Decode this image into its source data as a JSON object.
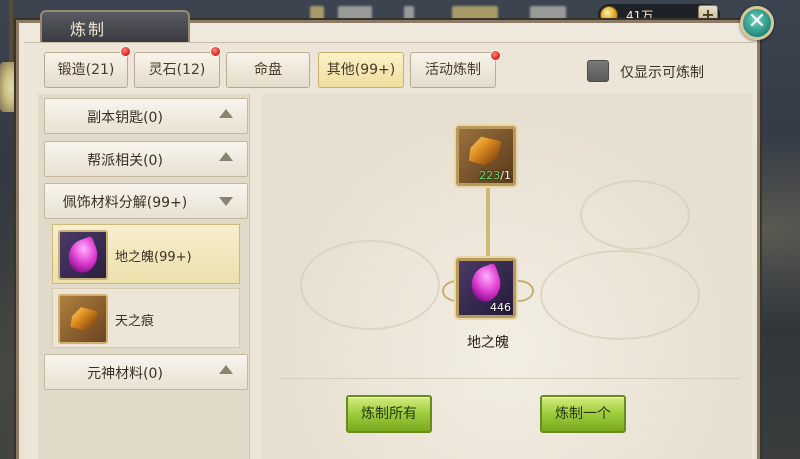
{
  "window": {
    "title": "炼制"
  },
  "currency": {
    "amount": "41万",
    "add_label": "+"
  },
  "close_label": "✕",
  "tabs": [
    {
      "label": "锻造(21)",
      "badge": true,
      "active": false
    },
    {
      "label": "灵石(12)",
      "badge": true,
      "active": false
    },
    {
      "label": "命盘",
      "badge": false,
      "active": false
    },
    {
      "label": "其他(99+)",
      "badge": false,
      "active": true
    },
    {
      "label": "活动炼制",
      "badge": true,
      "active": false
    }
  ],
  "filter": {
    "label": "仅显示可炼制",
    "checked": false
  },
  "categories": [
    {
      "label": "副本钥匙(0)",
      "expanded": false
    },
    {
      "label": "帮派相关(0)",
      "expanded": false
    },
    {
      "label": "佩饰材料分解(99+)",
      "expanded": true
    },
    {
      "label": "元神材料(0)",
      "expanded": false
    }
  ],
  "items": [
    {
      "name": "地之魄(99+)",
      "icon": "purple-feather-icon",
      "selected": true
    },
    {
      "name": "天之痕",
      "icon": "amber-crystal-icon",
      "selected": false
    }
  ],
  "recipe": {
    "ingredient": {
      "have": "223",
      "need": "/1",
      "icon": "amber-crystal-icon"
    },
    "product": {
      "name": "地之魄",
      "count": "446",
      "icon": "purple-feather-icon"
    }
  },
  "actions": {
    "craft_all": "炼制所有",
    "craft_one": "炼制一个"
  },
  "colors": {
    "accent_green": "#9ccc3a",
    "badge_red": "#d81818",
    "active_tab": "#f0dea0"
  }
}
